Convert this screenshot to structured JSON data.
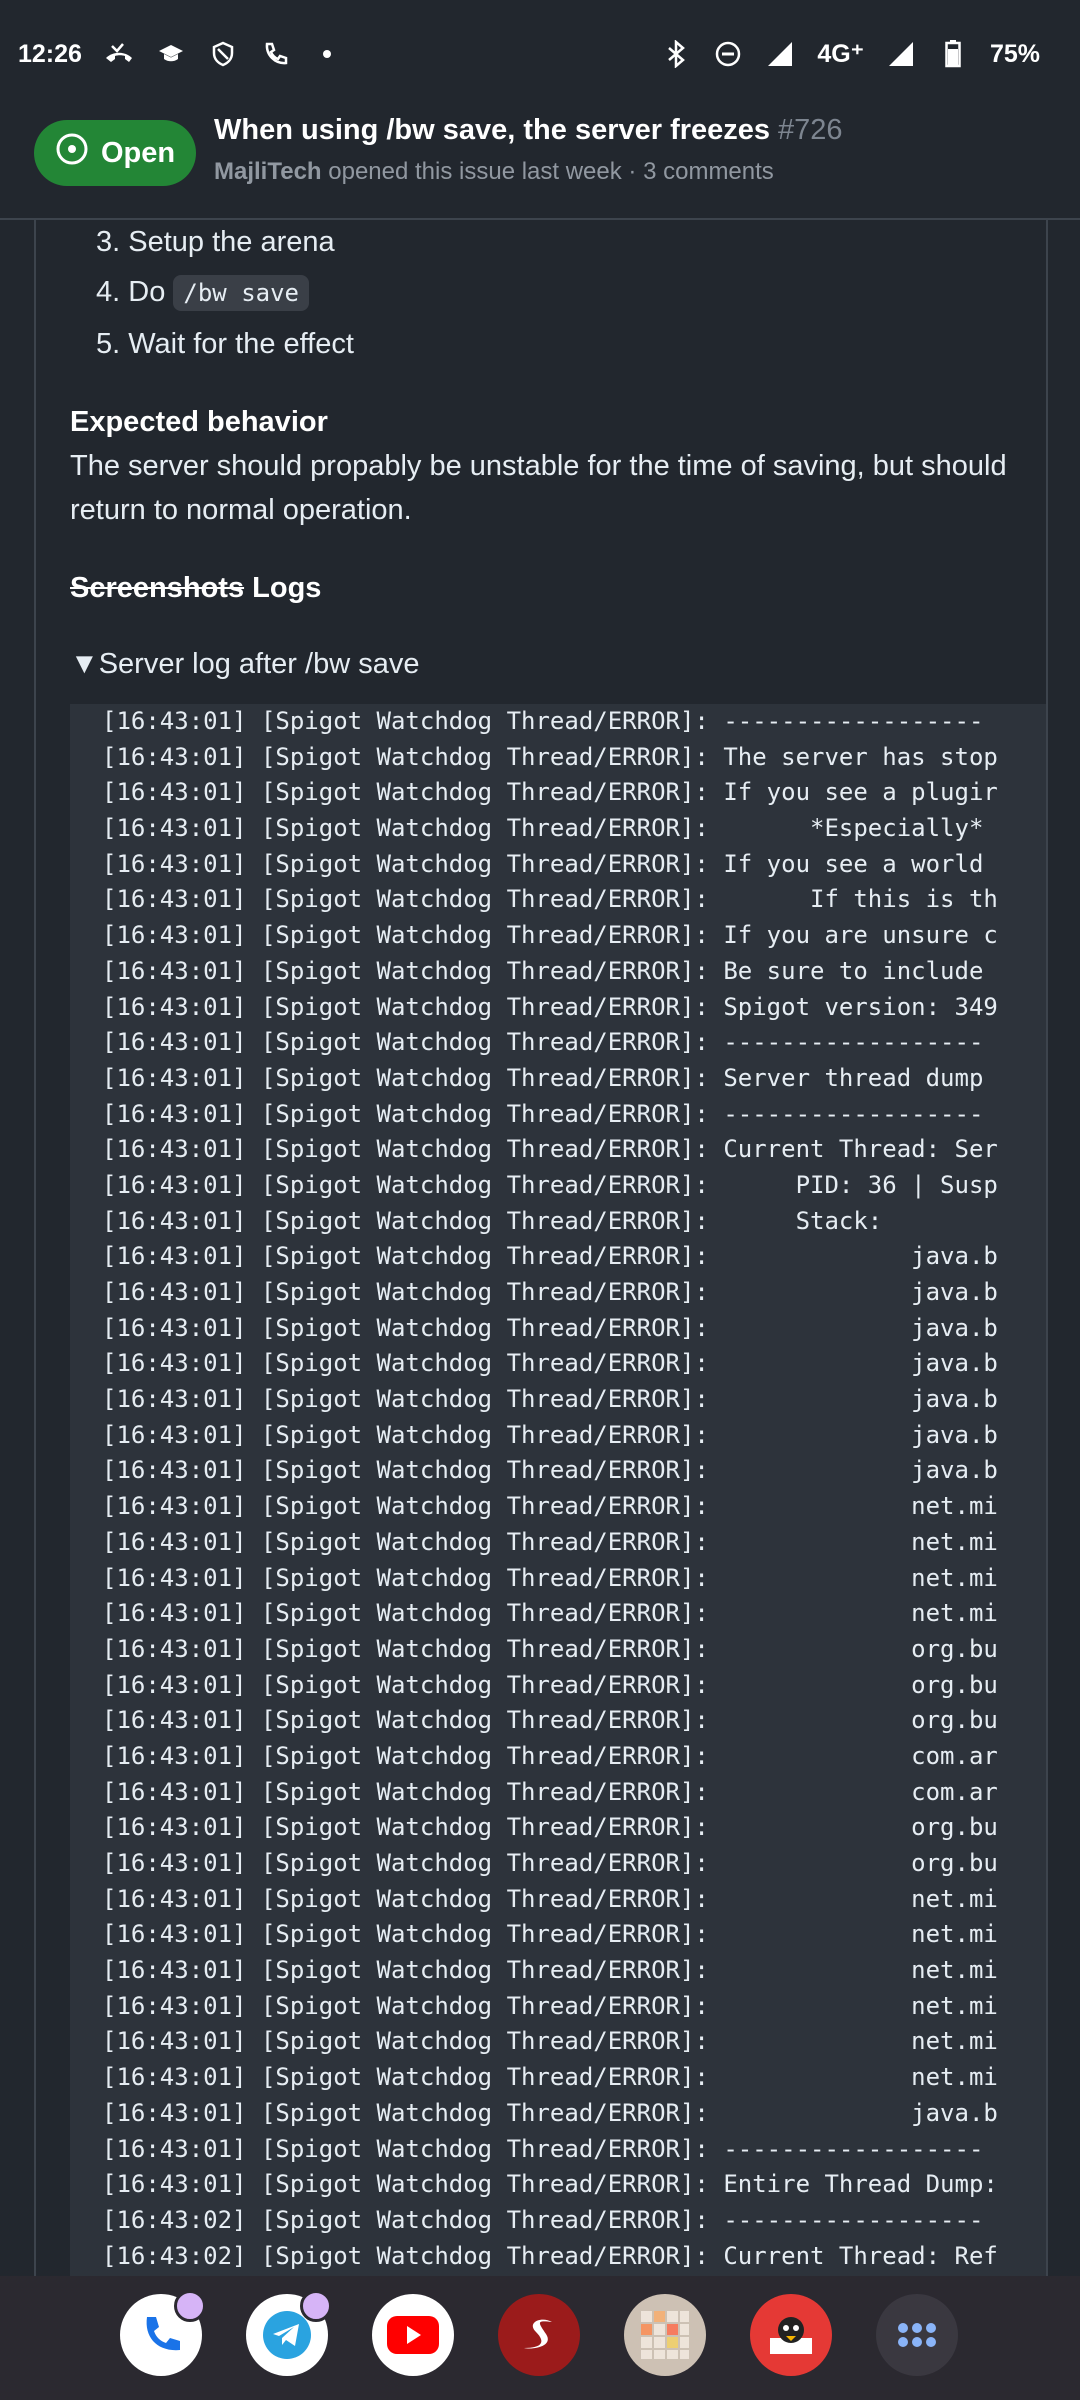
{
  "status_bar": {
    "time": "12:26",
    "network": "4G⁺",
    "battery": "75%",
    "left_icons": [
      "missed-call-icon",
      "school-icon",
      "shield-icon",
      "phone-icon",
      "dot-icon"
    ],
    "right_icons": [
      "bluetooth-icon",
      "do-not-disturb-icon",
      "signal-icon",
      "signal-icon",
      "battery-icon"
    ]
  },
  "issue": {
    "state": "Open",
    "title": "When using /bw save, the server freezes",
    "number": "#726",
    "author": "MajliTech",
    "meta_rest": " opened this issue last week · 3 comments",
    "state_color": "#238636"
  },
  "body": {
    "steps": [
      {
        "num": "3.",
        "text": "Setup the arena"
      },
      {
        "num": "4.",
        "text": "Do ",
        "code": "/bw save"
      },
      {
        "num": "5.",
        "text": "Wait for the effect"
      }
    ],
    "expected_heading": "Expected behavior",
    "expected_text": "The server should propably be unstable for the time of saving, but should return to normal operation.",
    "logs_heading_struck": "Screenshots",
    "logs_heading": " Logs",
    "details_summary": "▼Server log after /bw save",
    "log_lines": [
      "[16:43:01] [Spigot Watchdog Thread/ERROR]: ------------------",
      "[16:43:01] [Spigot Watchdog Thread/ERROR]: The server has stop",
      "[16:43:01] [Spigot Watchdog Thread/ERROR]: If you see a plugir",
      "[16:43:01] [Spigot Watchdog Thread/ERROR]:       *Especially*",
      "[16:43:01] [Spigot Watchdog Thread/ERROR]: If you see a world",
      "[16:43:01] [Spigot Watchdog Thread/ERROR]:       If this is th",
      "[16:43:01] [Spigot Watchdog Thread/ERROR]: If you are unsure c",
      "[16:43:01] [Spigot Watchdog Thread/ERROR]: Be sure to include",
      "[16:43:01] [Spigot Watchdog Thread/ERROR]: Spigot version: 349",
      "[16:43:01] [Spigot Watchdog Thread/ERROR]: ------------------",
      "[16:43:01] [Spigot Watchdog Thread/ERROR]: Server thread dump",
      "[16:43:01] [Spigot Watchdog Thread/ERROR]: ------------------",
      "[16:43:01] [Spigot Watchdog Thread/ERROR]: Current Thread: Ser",
      "[16:43:01] [Spigot Watchdog Thread/ERROR]:      PID: 36 | Susp",
      "[16:43:01] [Spigot Watchdog Thread/ERROR]:      Stack:",
      "[16:43:01] [Spigot Watchdog Thread/ERROR]:              java.b",
      "[16:43:01] [Spigot Watchdog Thread/ERROR]:              java.b",
      "[16:43:01] [Spigot Watchdog Thread/ERROR]:              java.b",
      "[16:43:01] [Spigot Watchdog Thread/ERROR]:              java.b",
      "[16:43:01] [Spigot Watchdog Thread/ERROR]:              java.b",
      "[16:43:01] [Spigot Watchdog Thread/ERROR]:              java.b",
      "[16:43:01] [Spigot Watchdog Thread/ERROR]:              java.b",
      "[16:43:01] [Spigot Watchdog Thread/ERROR]:              net.mi",
      "[16:43:01] [Spigot Watchdog Thread/ERROR]:              net.mi",
      "[16:43:01] [Spigot Watchdog Thread/ERROR]:              net.mi",
      "[16:43:01] [Spigot Watchdog Thread/ERROR]:              net.mi",
      "[16:43:01] [Spigot Watchdog Thread/ERROR]:              org.bu",
      "[16:43:01] [Spigot Watchdog Thread/ERROR]:              org.bu",
      "[16:43:01] [Spigot Watchdog Thread/ERROR]:              org.bu",
      "[16:43:01] [Spigot Watchdog Thread/ERROR]:              com.ar",
      "[16:43:01] [Spigot Watchdog Thread/ERROR]:              com.ar",
      "[16:43:01] [Spigot Watchdog Thread/ERROR]:              org.bu",
      "[16:43:01] [Spigot Watchdog Thread/ERROR]:              org.bu",
      "[16:43:01] [Spigot Watchdog Thread/ERROR]:              net.mi",
      "[16:43:01] [Spigot Watchdog Thread/ERROR]:              net.mi",
      "[16:43:01] [Spigot Watchdog Thread/ERROR]:              net.mi",
      "[16:43:01] [Spigot Watchdog Thread/ERROR]:              net.mi",
      "[16:43:01] [Spigot Watchdog Thread/ERROR]:              net.mi",
      "[16:43:01] [Spigot Watchdog Thread/ERROR]:              net.mi",
      "[16:43:01] [Spigot Watchdog Thread/ERROR]:              java.b",
      "[16:43:01] [Spigot Watchdog Thread/ERROR]: ------------------",
      "[16:43:01] [Spigot Watchdog Thread/ERROR]: Entire Thread Dump:",
      "[16:43:02] [Spigot Watchdog Thread/ERROR]: ------------------",
      "[16:43:02] [Spigot Watchdog Thread/ERROR]: Current Thread: Ref"
    ]
  },
  "dock": {
    "apps": [
      {
        "name": "phone-app-icon",
        "bg": "#ffffff",
        "notif": true
      },
      {
        "name": "telegram-app-icon",
        "bg": "#ffffff",
        "notif": true
      },
      {
        "name": "youtube-app-icon",
        "bg": "#ffffff",
        "notif": false
      },
      {
        "name": "s-app-icon",
        "bg": "#9b1b1b",
        "notif": false
      },
      {
        "name": "2048-game-app-icon",
        "bg": "#cdc1b4",
        "notif": false
      },
      {
        "name": "reader-app-icon",
        "bg": "#e53935",
        "notif": false
      },
      {
        "name": "app-drawer-icon",
        "bg": "#3a3840",
        "notif": false
      }
    ]
  }
}
